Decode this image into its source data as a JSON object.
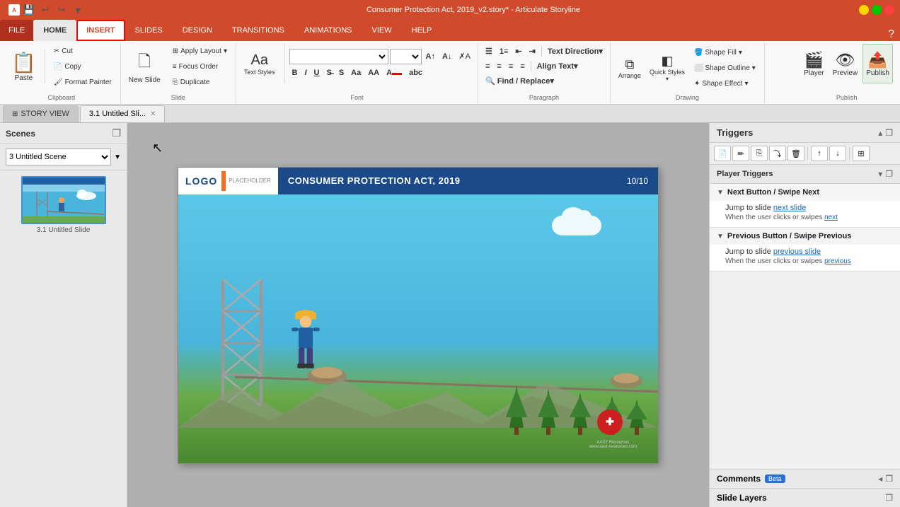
{
  "titlebar": {
    "title": "Consumer Protection Act, 2019_v2.story* - Articulate Storyline",
    "app_icon": "A"
  },
  "tabs": {
    "file": "FILE",
    "home": "HOME",
    "insert": "INSERT",
    "slides": "SLIDES",
    "design": "DESIGN",
    "transitions": "TRANSITIONS",
    "animations": "ANIMATIONS",
    "view": "VIEW",
    "help": "HELP"
  },
  "ribbon": {
    "clipboard": {
      "group_label": "Clipboard",
      "paste": "Paste",
      "cut": "Cut",
      "copy": "Copy",
      "format_painter": "Format Painter"
    },
    "slide": {
      "group_label": "Slide",
      "new_slide": "New Slide",
      "apply_layout": "Apply Layout",
      "focus_order": "Focus Order",
      "duplicate": "Duplicate"
    },
    "font": {
      "group_label": "Font",
      "font_name": "",
      "font_size": "",
      "bold": "B",
      "italic": "I",
      "underline": "U",
      "strikethrough": "S",
      "text_styles": "Text Styles"
    },
    "paragraph": {
      "group_label": "Paragraph",
      "text_direction": "Text Direction",
      "align_text": "Align Text",
      "find_replace": "Find / Replace"
    },
    "drawing": {
      "group_label": "Drawing",
      "shape_fill": "Shape Fill",
      "shape_outline": "Shape Outline",
      "shape_effect": "Shape Effect",
      "arrange": "Arrange",
      "quick_styles": "Quick Styles"
    },
    "publish_group": {
      "group_label": "Publish",
      "player": "Player",
      "preview": "Preview",
      "publish": "Publish"
    }
  },
  "view_tabs": {
    "story_view": "STORY VIEW",
    "slide_tab": "3.1 Untitled Sli..."
  },
  "scenes": {
    "title": "Scenes",
    "scene_dropdown_value": "3  Untitled Scene",
    "slides": [
      {
        "label": "3.1 Untitled Slide",
        "number": "3.1"
      }
    ]
  },
  "slide": {
    "logo_text": "LOGO PLACEHOLDER",
    "title": "CONSUMER PROTECTION ACT, 2019",
    "page": "10/10",
    "company_text": "AAST Resources\nwww.aast-resources.com"
  },
  "triggers": {
    "panel_title": "Triggers",
    "player_triggers_title": "Player Triggers",
    "next_section": {
      "title": "Next Button / Swipe Next",
      "action": "Jump to slide",
      "action_link": "next slide",
      "condition": "When the user clicks or swipes",
      "condition_link": "next"
    },
    "prev_section": {
      "title": "Previous Button / Swipe Previous",
      "action": "Jump to slide",
      "action_link": "previous slide",
      "condition": "When the user clicks or swipes",
      "condition_link": "previous"
    }
  },
  "comments": {
    "title": "Comments",
    "beta_label": "Beta"
  },
  "slide_layers": {
    "title": "Slide Layers"
  },
  "icons": {
    "paste": "📋",
    "cut": "✂",
    "copy": "📄",
    "format_painter": "🖌",
    "new_slide": "🗋",
    "undo": "↩",
    "redo": "↪",
    "save": "💾",
    "bold": "B",
    "italic": "I",
    "underline": "U",
    "player": "▶",
    "preview": "👁",
    "publish": "📤",
    "doc": "📄",
    "copy2": "⎘",
    "move": "⤵",
    "delete": "🗑",
    "up": "↑",
    "down": "↓",
    "left": "←",
    "right": "→",
    "grid": "⊞",
    "chevron_down": "▼",
    "chevron_right": "▶",
    "settings": "⚙",
    "restore": "❐",
    "close": "✕"
  }
}
